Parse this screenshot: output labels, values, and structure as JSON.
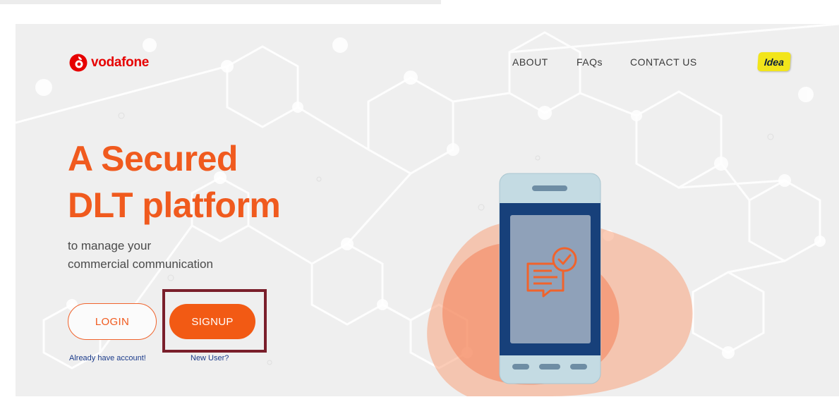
{
  "brand": {
    "logo_text": "vodafone",
    "partner_logo_text": "Idea",
    "colors": {
      "primary": "#f05a1e",
      "vodafone_red": "#e60000",
      "idea_yellow": "#f2e51b",
      "frame": "#7a1f2b"
    }
  },
  "nav": {
    "items": [
      {
        "label": "ABOUT"
      },
      {
        "label": "FAQs"
      },
      {
        "label": "CONTACT US"
      }
    ]
  },
  "hero": {
    "headline_line1": "A Secured",
    "headline_line2": "DLT platform",
    "sub_line1": "to manage your",
    "sub_line2": "commercial communication"
  },
  "actions": {
    "login_label": "LOGIN",
    "login_caption": "Already have account!",
    "signup_label": "SIGNUP",
    "signup_caption": "New User?"
  },
  "illustration": {
    "icons": [
      "smartphone-icon",
      "chat-message-icon",
      "checkmark-icon"
    ]
  }
}
